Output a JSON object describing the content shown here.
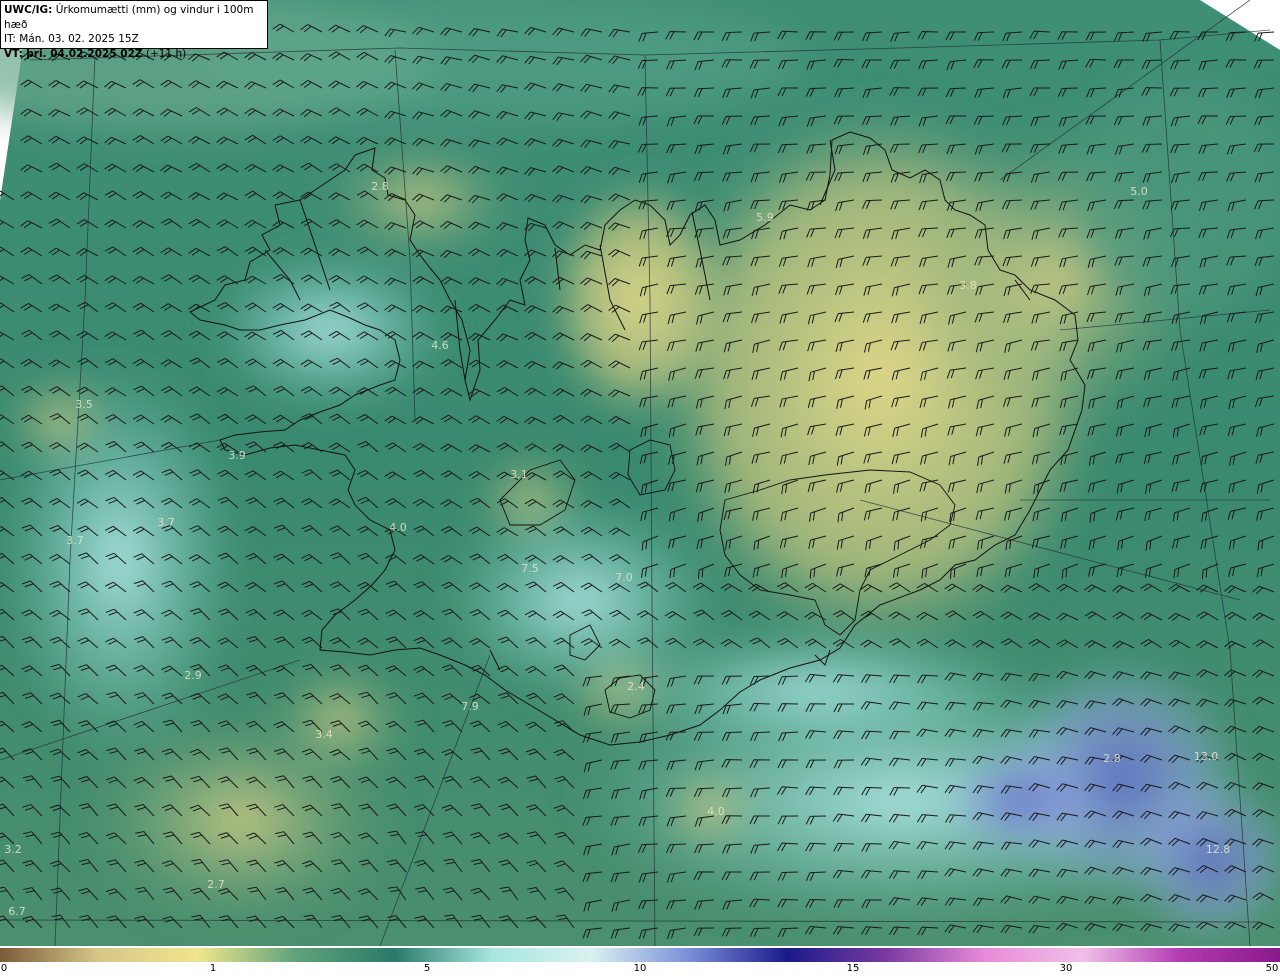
{
  "header": {
    "model": "UWC/IG:",
    "title": "Úrkomumætti (mm) og vindur i 100m hæð",
    "init_label": "IT:",
    "init_time": "Mán. 03. 02. 2025 15Z",
    "valid_label": "VT:",
    "valid_time": "þri. 04.02.2025 02Z",
    "lead_time": "(+11 h)"
  },
  "map_labels": [
    "2.8",
    "5.9",
    "5.0",
    "3.8",
    "4.6",
    "3.5",
    "3.9",
    "3.1",
    "3.7",
    "4.0",
    "3.7",
    "7.5",
    "7.0",
    "2.9",
    "2.4",
    "7.9",
    "3.4",
    "4.0",
    "2.8",
    "13.0",
    "12.8",
    "3.2",
    "2.7",
    "6.7"
  ],
  "colorbar": {
    "ticks": [
      "0",
      "1",
      "5",
      "10",
      "15",
      "30",
      "50"
    ],
    "colors": [
      "#7b5b3a",
      "#d6c788",
      "#f0e68c",
      "#5fa37a",
      "#2a7a68",
      "#a8e6df",
      "#d8f2ef",
      "#7a8fd8",
      "#1a1a8a",
      "#7a3aa0",
      "#e88ad8",
      "#f0c0e8",
      "#b03ab0",
      "#8a1a8a"
    ]
  },
  "legend_icons": [
    "wind-barb-icon"
  ]
}
